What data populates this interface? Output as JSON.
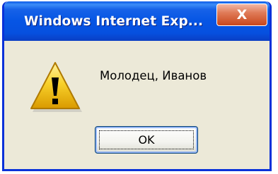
{
  "window": {
    "title": "Windows Internet Exp...",
    "close_label": "X"
  },
  "dialog": {
    "icon": "warning-icon",
    "message": "Молодец, Иванов",
    "ok_label": "OK"
  },
  "colors": {
    "titlebar": "#0655e4",
    "frame": "#0831d9",
    "body": "#ece9d8",
    "close_button": "#e07b58",
    "warning_yellow": "#f5c400"
  }
}
